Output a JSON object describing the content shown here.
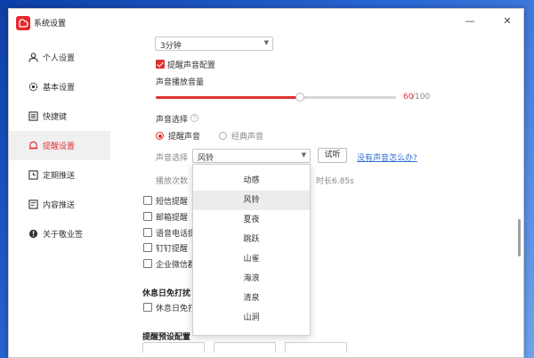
{
  "window": {
    "title": "系统设置",
    "minimize_glyph": "—",
    "close_glyph": "✕"
  },
  "sidebar": {
    "items": [
      {
        "label": "个人设置",
        "icon": "person-icon"
      },
      {
        "label": "基本设置",
        "icon": "gear-icon"
      },
      {
        "label": "快捷键",
        "icon": "keyboard-icon"
      },
      {
        "label": "提醒设置",
        "icon": "bell-icon",
        "active": true
      },
      {
        "label": "定期推送",
        "icon": "clock-icon"
      },
      {
        "label": "内容推送",
        "icon": "document-icon"
      },
      {
        "label": "关于敬业签",
        "icon": "info-icon"
      }
    ]
  },
  "content": {
    "interval_select": "3分钟",
    "sound_config_label": "提醒声音配置",
    "volume_label": "声音播放音量",
    "volume_value": "60",
    "volume_max": "/100",
    "volume_fraction": 0.6,
    "sound_choice_heading": "声音选择",
    "help_glyph": "?",
    "radio_reminder": "提醒声音",
    "radio_classic": "经典声音",
    "sound_select_label": "声音选择",
    "sound_select_value": "风铃",
    "try_button": "试听",
    "no_sound_link": "没有声音怎么办?",
    "play_count_label": "播放次数",
    "duration_text": "时长6.85s",
    "notify_sms": "短信提醒",
    "notify_email": "邮箱提醒",
    "notify_voice": "语音电话提",
    "notify_dingtalk": "钉钉提醒",
    "notify_wecom": "企业微信群",
    "rest_day_heading": "休息日免打扰",
    "rest_day_checkbox": "休息日免打",
    "preset_heading": "提醒预设配置"
  },
  "dropdown": {
    "options": [
      "动感",
      "风铃",
      "夏夜",
      "跳跃",
      "山雀",
      "海浪",
      "清泉",
      "山涧"
    ],
    "hovered": "风铃"
  },
  "colors": {
    "accent": "#e03131",
    "link": "#2f6fd6",
    "active_nav_bg": "#f0f0f0"
  }
}
